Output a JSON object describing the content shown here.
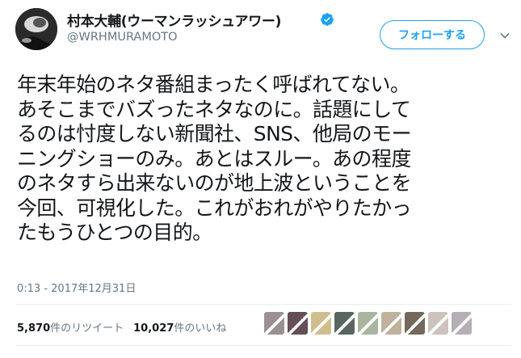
{
  "user": {
    "display_name": "村本大輔(ウーマンラッシュアワー)",
    "handle": "@WRHMURAMOTO",
    "verified_icon": "verified-badge-icon"
  },
  "follow_button": {
    "label": "フォローする"
  },
  "tweet": {
    "text": "年末年始のネタ番組まったく呼ばれてない。\nあそこまでバズったネタなのに。話題にして\nるのは忖度しない新聞社、SNS、他局のモー\nニングショーのみ。あとはスルー。あの程度\nのネタすら出来ないのが地上波ということを\n今回、可視化した。これがおれがやりたかっ\nたもうひとつの目的。",
    "timestamp": "0:13 - 2017年12月31日"
  },
  "stats": {
    "retweets_count": "5,870",
    "retweets_label": "件のリツイート",
    "likes_count": "10,027",
    "likes_label": "件のいいね"
  },
  "likers_colors": [
    "#8a7c80",
    "#4a2f38",
    "#c9b27a",
    "#3c4a44",
    "#9aa88e",
    "#b6a48c",
    "#5a4e3e",
    "#c4b8b0",
    "#a8a0a8"
  ],
  "colors": {
    "accent": "#1da1f2",
    "secondary_text": "#657786"
  }
}
